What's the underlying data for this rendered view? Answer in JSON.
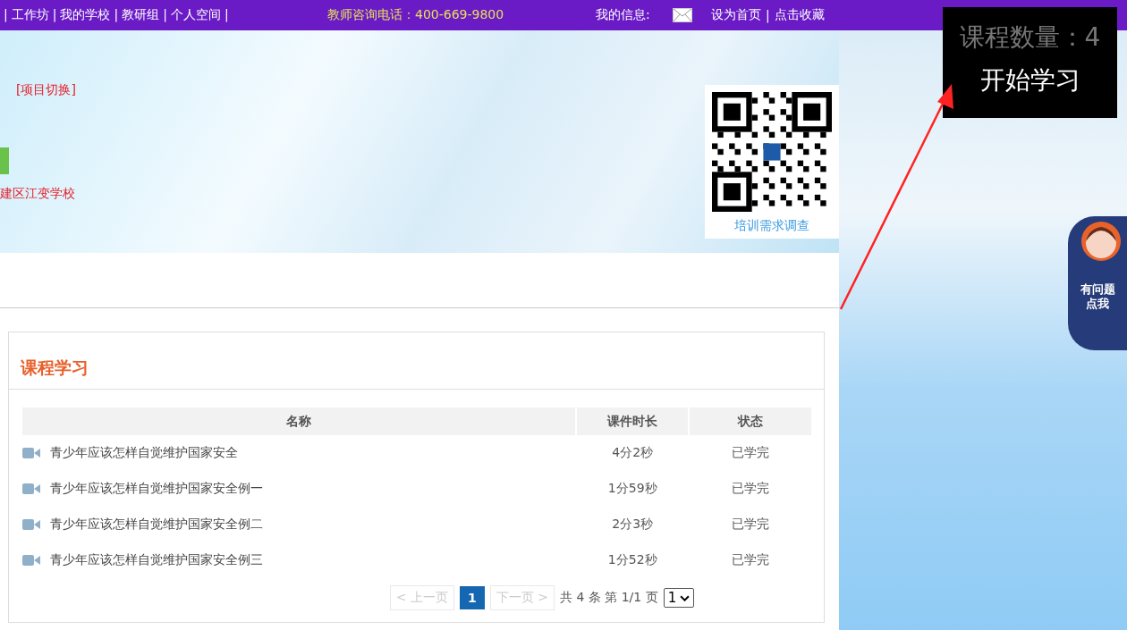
{
  "top_bar": {
    "separator": "|",
    "nav_links": [
      "工作坊",
      "我的学校",
      "教研组",
      "个人空间"
    ],
    "hotline": "教师咨询电话：400-669-9800",
    "message_label": "我的信息:",
    "actions": [
      "设为首页",
      "点击收藏"
    ]
  },
  "banner": {
    "switch_link": "[项目切换]",
    "school": "建区江变学校",
    "qr_caption": "培训需求调查"
  },
  "overlay": {
    "count_label": "课程数量：4",
    "start_button": "开始学习"
  },
  "helper": {
    "text": "有问题点我"
  },
  "course_panel": {
    "title": "课程学习",
    "columns": [
      "名称",
      "课件时长",
      "状态"
    ],
    "rows": [
      {
        "name": "青少年应该怎样自觉维护国家安全",
        "duration": "4分2秒",
        "status": "已学完"
      },
      {
        "name": "青少年应该怎样自觉维护国家安全例一",
        "duration": "1分59秒",
        "status": "已学完"
      },
      {
        "name": "青少年应该怎样自觉维护国家安全例二",
        "duration": "2分3秒",
        "status": "已学完"
      },
      {
        "name": "青少年应该怎样自觉维护国家安全例三",
        "duration": "1分52秒",
        "status": "已学完"
      }
    ],
    "pagination": {
      "prev": {
        "label": "< 上一页",
        "disabled": true
      },
      "pages": [
        {
          "label": "1",
          "selected": true
        }
      ],
      "next": {
        "label": "下一页 >",
        "disabled": true
      },
      "summary": "共 4 条 第 1/1 页",
      "page_select": "1"
    }
  }
}
